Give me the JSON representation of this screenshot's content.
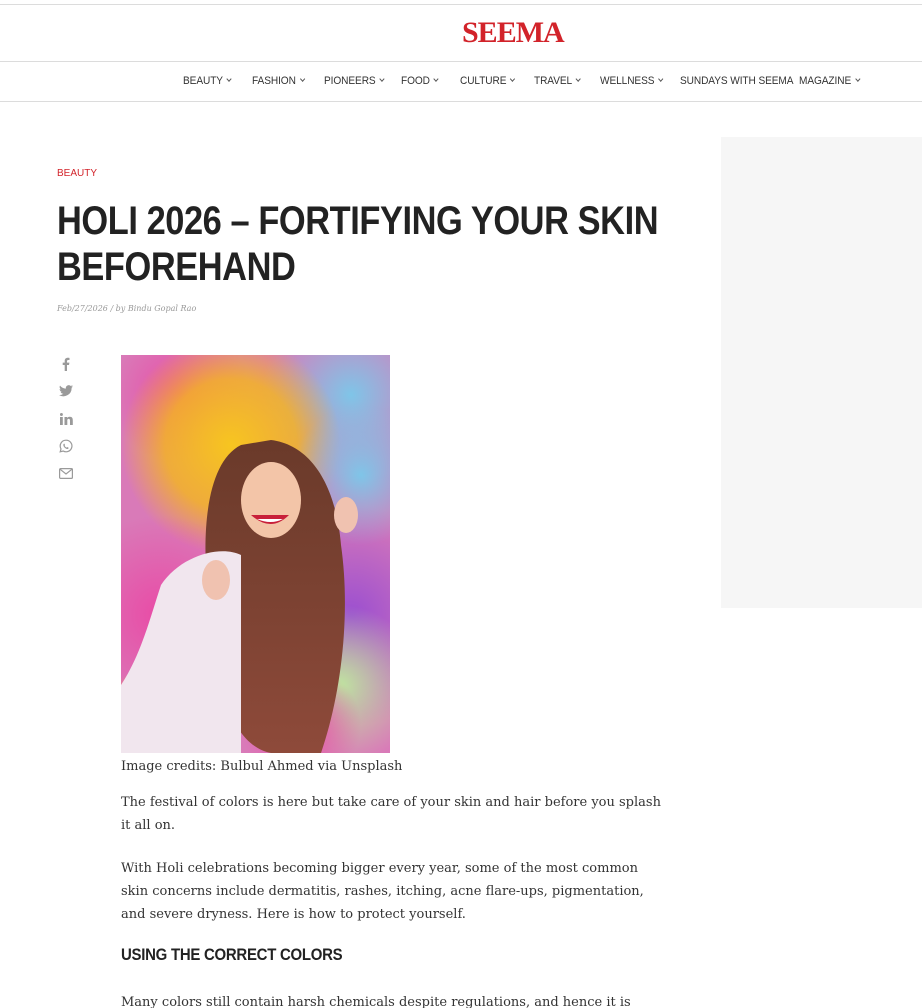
{
  "site": {
    "logo_text": "SEEMA",
    "brand_color": "#d2232a"
  },
  "nav": {
    "items": [
      {
        "label": "BEAUTY",
        "has_dropdown": true
      },
      {
        "label": "FASHION",
        "has_dropdown": true
      },
      {
        "label": "PIONEERS",
        "has_dropdown": true
      },
      {
        "label": "FOOD",
        "has_dropdown": true
      },
      {
        "label": "CULTURE",
        "has_dropdown": true
      },
      {
        "label": "TRAVEL",
        "has_dropdown": true
      },
      {
        "label": "WELLNESS",
        "has_dropdown": true
      },
      {
        "label": "SUNDAYS WITH SEEMA",
        "has_dropdown": false
      },
      {
        "label": "MAGAZINE",
        "has_dropdown": true
      }
    ]
  },
  "article": {
    "category": "BEAUTY",
    "title": "HOLI 2026 – FORTIFYING YOUR SKIN BEFOREHAND",
    "meta": "Feb/27/2026 / by Bindu Gopal Rao",
    "image_caption": "Image credits: Bulbul Ahmed via Unsplash",
    "paragraphs": [
      "The festival of colors is here but take care of your skin and hair before you splash it all on.",
      "With Holi celebrations becoming bigger every year, some of the most common skin concerns include dermatitis, rashes, itching, acne flare-ups, pigmentation, and severe dryness. Here is how to protect yourself."
    ],
    "subheading": "USING THE CORRECT COLORS",
    "partial_paragraph": "Many colors still contain harsh chemicals despite regulations, and hence it is important"
  },
  "share_icons": [
    "facebook-icon",
    "twitter-icon",
    "linkedin-icon",
    "whatsapp-icon",
    "email-icon"
  ]
}
